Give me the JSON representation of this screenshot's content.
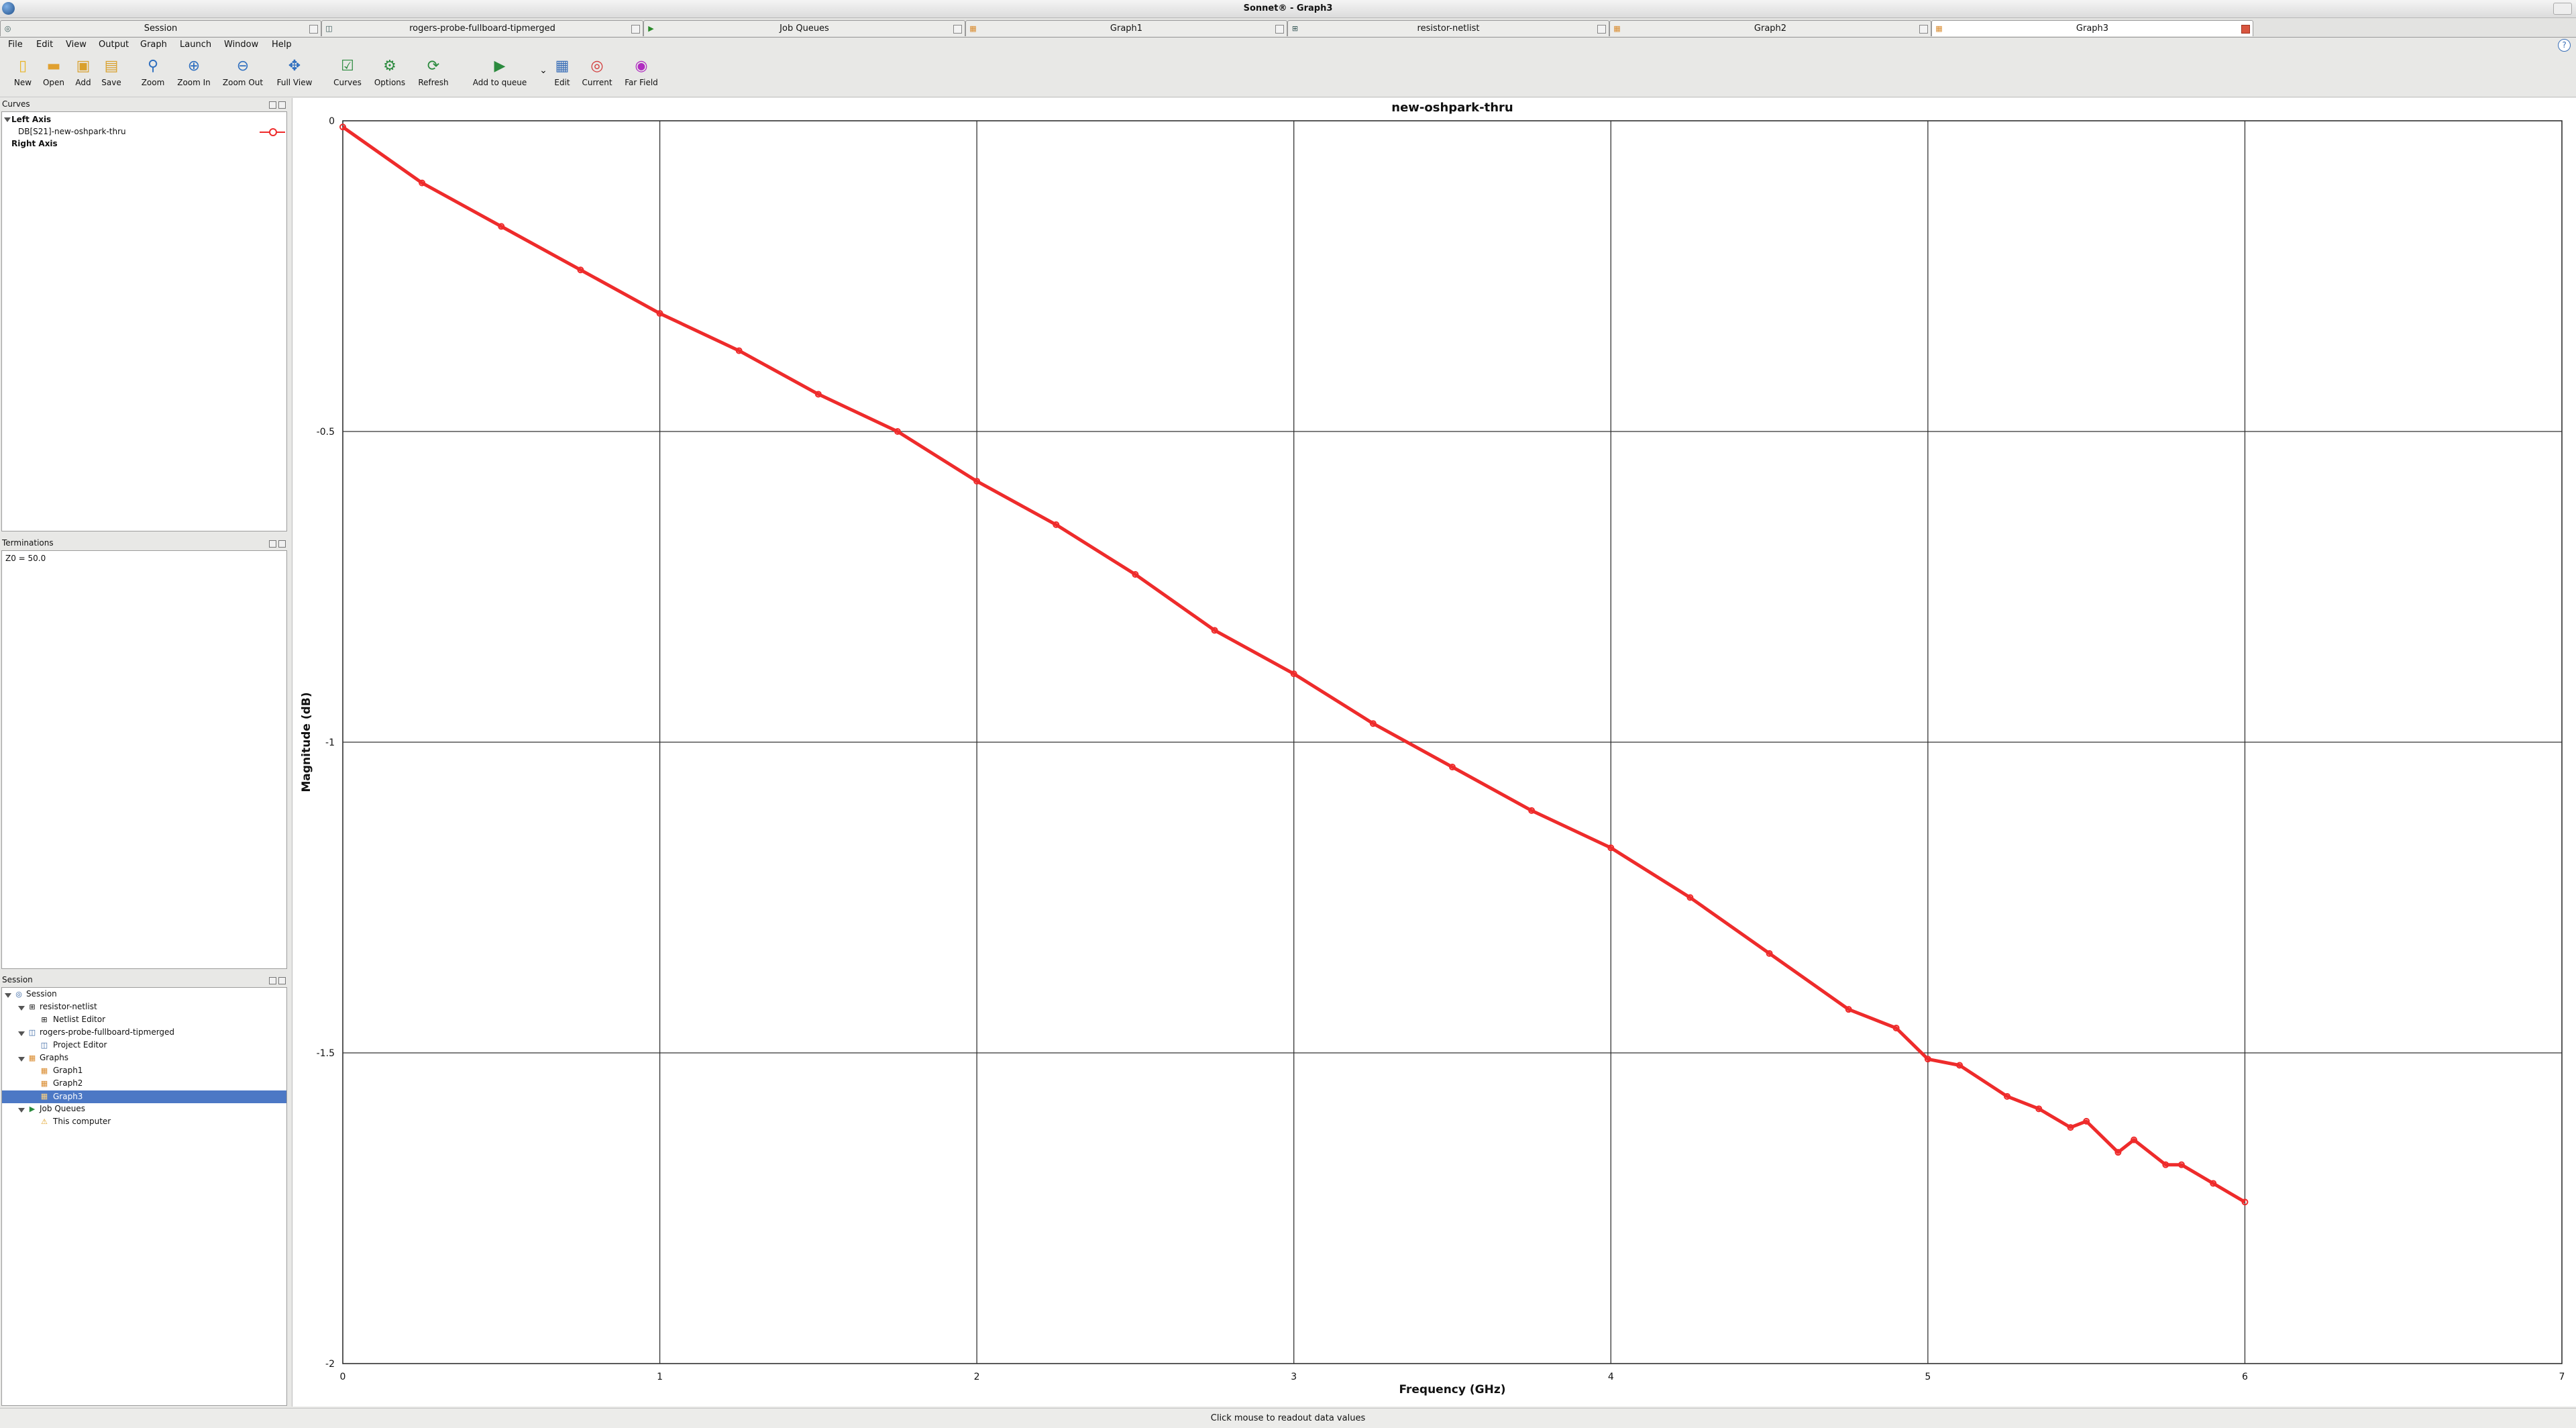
{
  "window": {
    "title": "Sonnet® - Graph3"
  },
  "tabs": [
    {
      "label": "Session",
      "icon": "session-icon"
    },
    {
      "label": "rogers-probe-fullboard-tipmerged",
      "icon": "project-icon"
    },
    {
      "label": "Job Queues",
      "icon": "job-queue-icon"
    },
    {
      "label": "Graph1",
      "icon": "graph-icon"
    },
    {
      "label": "resistor-netlist",
      "icon": "netlist-icon"
    },
    {
      "label": "Graph2",
      "icon": "graph-icon"
    },
    {
      "label": "Graph3",
      "icon": "graph-icon",
      "active": true
    }
  ],
  "menu": [
    "File",
    "Edit",
    "View",
    "Output",
    "Graph",
    "Launch",
    "Window",
    "Help"
  ],
  "toolbar": {
    "new": "New",
    "open": "Open",
    "add": "Add",
    "save": "Save",
    "zoom": "Zoom",
    "zoom_in": "Zoom In",
    "zoom_out": "Zoom Out",
    "full_view": "Full View",
    "curves": "Curves",
    "options": "Options",
    "refresh": "Refresh",
    "add_to_queue": "Add to queue",
    "edit": "Edit",
    "current": "Current",
    "far_field": "Far Field"
  },
  "curves_panel": {
    "title": "Curves",
    "left_axis": "Left Axis",
    "curve_name": "DB[S21]-new-oshpark-thru",
    "right_axis": "Right Axis"
  },
  "terminations_panel": {
    "title": "Terminations",
    "value": "Z0 = 50.0"
  },
  "session_panel": {
    "title": "Session",
    "root": "Session",
    "items": [
      {
        "label": "resistor-netlist"
      },
      {
        "label": "Netlist Editor"
      },
      {
        "label": "rogers-probe-fullboard-tipmerged"
      },
      {
        "label": "Project Editor"
      },
      {
        "label": "Graphs"
      },
      {
        "label": "Graph1"
      },
      {
        "label": "Graph2"
      },
      {
        "label": "Graph3"
      },
      {
        "label": "Job Queues"
      },
      {
        "label": "This computer"
      }
    ]
  },
  "status": "Click mouse to readout data values",
  "colors": {
    "curve": "#ee2b2b",
    "selection": "#4c78c5"
  },
  "chart_data": {
    "type": "line",
    "title": "new-oshpark-thru",
    "xlabel": "Frequency (GHz)",
    "ylabel": "Magnitude (dB)",
    "xlim": [
      0,
      7
    ],
    "ylim": [
      -2,
      0
    ],
    "x_ticks": [
      "0",
      "1",
      "2",
      "3",
      "4",
      "5",
      "6",
      "7"
    ],
    "y_ticks": [
      "0",
      "-0.5",
      "-1",
      "-1.5",
      "-2"
    ],
    "grid": true,
    "series": [
      {
        "name": "DB[S21]-new-oshpark-thru",
        "x": [
          0,
          0.25,
          0.5,
          0.75,
          1,
          1.25,
          1.5,
          1.75,
          2,
          2.25,
          2.5,
          2.75,
          3,
          3.25,
          3.5,
          3.75,
          4,
          4.25,
          4.5,
          4.75,
          4.9,
          5,
          5.1,
          5.25,
          5.35,
          5.45,
          5.5,
          5.6,
          5.65,
          5.75,
          5.8,
          5.9,
          6
        ],
        "y": [
          -0.01,
          -0.1,
          -0.17,
          -0.24,
          -0.31,
          -0.37,
          -0.44,
          -0.5,
          -0.58,
          -0.65,
          -0.73,
          -0.82,
          -0.89,
          -0.97,
          -1.04,
          -1.11,
          -1.17,
          -1.25,
          -1.34,
          -1.43,
          -1.46,
          -1.51,
          -1.52,
          -1.57,
          -1.59,
          -1.62,
          -1.61,
          -1.66,
          -1.64,
          -1.68,
          -1.68,
          -1.71,
          -1.74
        ]
      }
    ]
  }
}
